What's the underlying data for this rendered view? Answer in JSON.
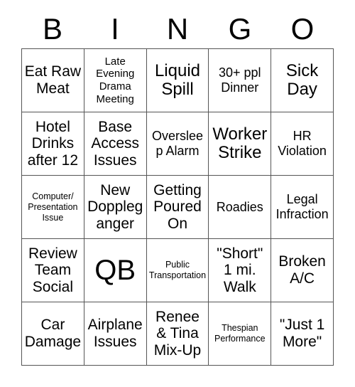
{
  "card": {
    "header_letters": [
      "B",
      "I",
      "N",
      "G",
      "O"
    ],
    "columns": 5,
    "rows": 5,
    "border_color": "#555555",
    "text_color": "#000000",
    "background_color": "#ffffff",
    "cells": [
      {
        "text": "Eat Raw Meat",
        "size": "lg"
      },
      {
        "text": "Late Evening Drama Meeting",
        "size": "sm"
      },
      {
        "text": "Liquid Spill",
        "size": "xl"
      },
      {
        "text": "30+ ppl Dinner",
        "size": "md"
      },
      {
        "text": "Sick Day",
        "size": "xl"
      },
      {
        "text": "Hotel Drinks after 12",
        "size": "lg"
      },
      {
        "text": "Base Access Issues",
        "size": "lg"
      },
      {
        "text": "Oversleep Alarm",
        "size": "md"
      },
      {
        "text": "Worker Strike",
        "size": "xl"
      },
      {
        "text": "HR Violation",
        "size": "md"
      },
      {
        "text": "Computer/ Presentation Issue",
        "size": "xs"
      },
      {
        "text": "New Doppleganger",
        "size": "lg"
      },
      {
        "text": "Getting Poured On",
        "size": "lg"
      },
      {
        "text": "Roadies",
        "size": "md"
      },
      {
        "text": "Legal Infraction",
        "size": "md"
      },
      {
        "text": "Review Team Social",
        "size": "lg"
      },
      {
        "text": "QB",
        "size": "xxl"
      },
      {
        "text": "Public Transportation",
        "size": "xs"
      },
      {
        "text": "\"Short\" 1 mi. Walk",
        "size": "lg"
      },
      {
        "text": "Broken A/C",
        "size": "lg"
      },
      {
        "text": "Car Damage",
        "size": "lg"
      },
      {
        "text": "Airplane Issues",
        "size": "lg"
      },
      {
        "text": "Renee & Tina Mix-Up",
        "size": "lg"
      },
      {
        "text": "Thespian Performance",
        "size": "xs"
      },
      {
        "text": "\"Just 1 More\"",
        "size": "lg"
      }
    ]
  }
}
